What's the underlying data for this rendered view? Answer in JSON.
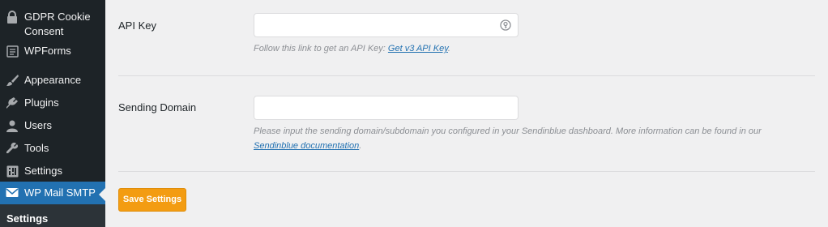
{
  "sidebar": {
    "items": [
      {
        "label": "GDPR Cookie Consent",
        "icon": "lock-icon"
      },
      {
        "label": "WPForms",
        "icon": "wpforms-icon"
      },
      {
        "label": "Appearance",
        "icon": "paintbrush-icon"
      },
      {
        "label": "Plugins",
        "icon": "plugin-icon"
      },
      {
        "label": "Users",
        "icon": "user-icon"
      },
      {
        "label": "Tools",
        "icon": "wrench-icon"
      },
      {
        "label": "Settings",
        "icon": "settings-icon"
      },
      {
        "label": "WP Mail SMTP",
        "icon": "mail-icon",
        "active": true
      }
    ],
    "submenu": {
      "label": "Settings"
    }
  },
  "fields": {
    "api_key": {
      "label": "API Key",
      "value": "",
      "help_text": "Follow this link to get an API Key: ",
      "help_link": "Get v3 API Key",
      "help_suffix": "."
    },
    "sending_domain": {
      "label": "Sending Domain",
      "value": "",
      "help_text": "Please input the sending domain/subdomain you configured in your Sendinblue dashboard. More information can be found in our ",
      "help_link": "Sendinblue documentation",
      "help_suffix": "."
    }
  },
  "actions": {
    "save_label": "Save Settings"
  },
  "colors": {
    "sidebar_bg": "#1d2327",
    "active_bg": "#2271b1",
    "button_bg": "#f39c12",
    "link": "#2271b1"
  }
}
